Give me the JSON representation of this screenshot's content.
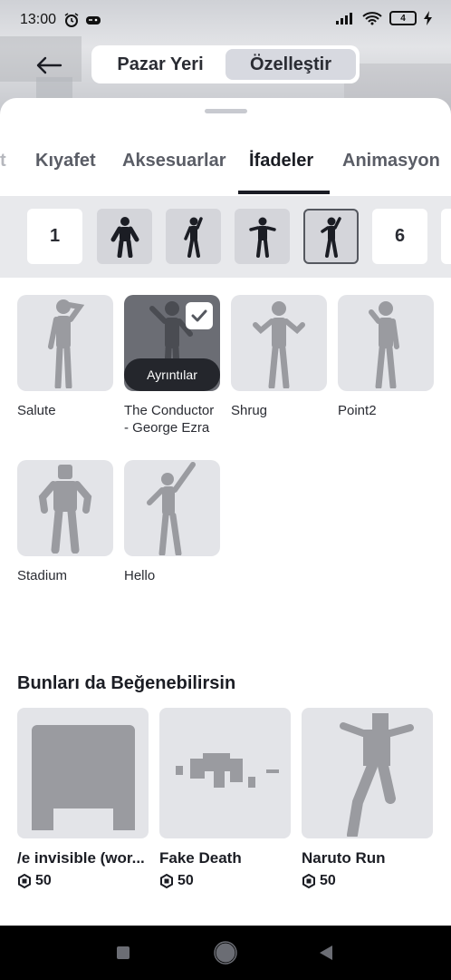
{
  "status_bar": {
    "time": "13:00",
    "battery": "4"
  },
  "header": {
    "segments": [
      {
        "label": "Pazar Yeri",
        "active": false
      },
      {
        "label": "Özelleştir",
        "active": true
      }
    ]
  },
  "tabs": [
    {
      "label": "t",
      "active": false
    },
    {
      "label": "Kıyafet",
      "active": false
    },
    {
      "label": "Aksesuarlar",
      "active": false
    },
    {
      "label": "İfadeler",
      "active": true
    },
    {
      "label": "Animasyon",
      "active": false
    }
  ],
  "slots": [
    {
      "type": "number",
      "label": "1"
    },
    {
      "type": "figure",
      "icon": "emote-figure-icon"
    },
    {
      "type": "figure",
      "icon": "emote-figure-icon"
    },
    {
      "type": "figure",
      "icon": "emote-figure-icon"
    },
    {
      "type": "figure",
      "icon": "emote-figure-icon",
      "selected": true
    },
    {
      "type": "number",
      "label": "6"
    }
  ],
  "emotes": [
    {
      "name": "Salute"
    },
    {
      "name": "The Conductor - George Ezra",
      "equipped": true,
      "details_label": "Ayrıntılar"
    },
    {
      "name": "Shrug"
    },
    {
      "name": "Point2"
    },
    {
      "name": "Stadium"
    },
    {
      "name": "Hello"
    }
  ],
  "recommendations": {
    "title": "Bunları da Beğenebilirsin",
    "items": [
      {
        "name": "/e invisible (wor...",
        "price": "50"
      },
      {
        "name": "Fake Death",
        "price": "50"
      },
      {
        "name": "Naruto Run",
        "price": "50"
      }
    ]
  },
  "colors": {
    "accent": "#1b1d24",
    "thumb_bg": "#e3e4e8",
    "slot_bar": "#e8e9ec"
  }
}
